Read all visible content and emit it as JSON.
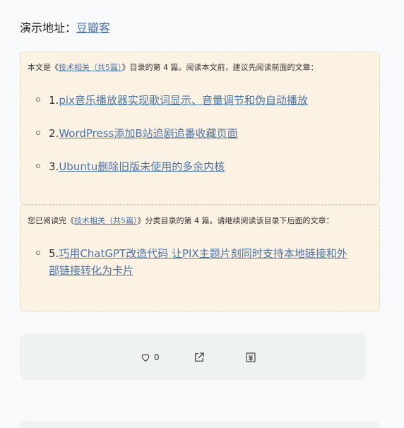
{
  "demo": {
    "label": "演示地址：",
    "link": "豆瓣客"
  },
  "series_top": {
    "prefix": "本文是《",
    "series_name": "技术相关（共5篇）",
    "suffix": "》目录的第 4 篇。阅读本文前，建议先阅读前面的文章：",
    "items": [
      {
        "num": "1.",
        "title": "pix音乐播放器实现歌词显示、音量调节和伪自动播放"
      },
      {
        "num": "2.",
        "title": "WordPress添加B站追剧追番收藏页面"
      },
      {
        "num": "3.",
        "title": "Ubuntu删除旧版未使用的多余内核"
      }
    ]
  },
  "series_bottom": {
    "prefix": "您已阅读完《",
    "series_name": "技术相关（共5篇）",
    "suffix": "》分类目录的第 4 篇。请继续阅读该目录下后面的文章：",
    "items": [
      {
        "num": "5.",
        "title_line1": "巧用ChatGPT改造代码 让PIX主题片刻同时支持本地链接和外",
        "title_line2": "部链接转化为卡片"
      }
    ]
  },
  "actions": {
    "like_count": "0",
    "icons": [
      "heart-icon",
      "share-icon",
      "donate-icon"
    ]
  },
  "colors": {
    "link": "#4a73a8",
    "series_bg": "#fbf2e4",
    "page_bg": "#f7f9fa"
  }
}
